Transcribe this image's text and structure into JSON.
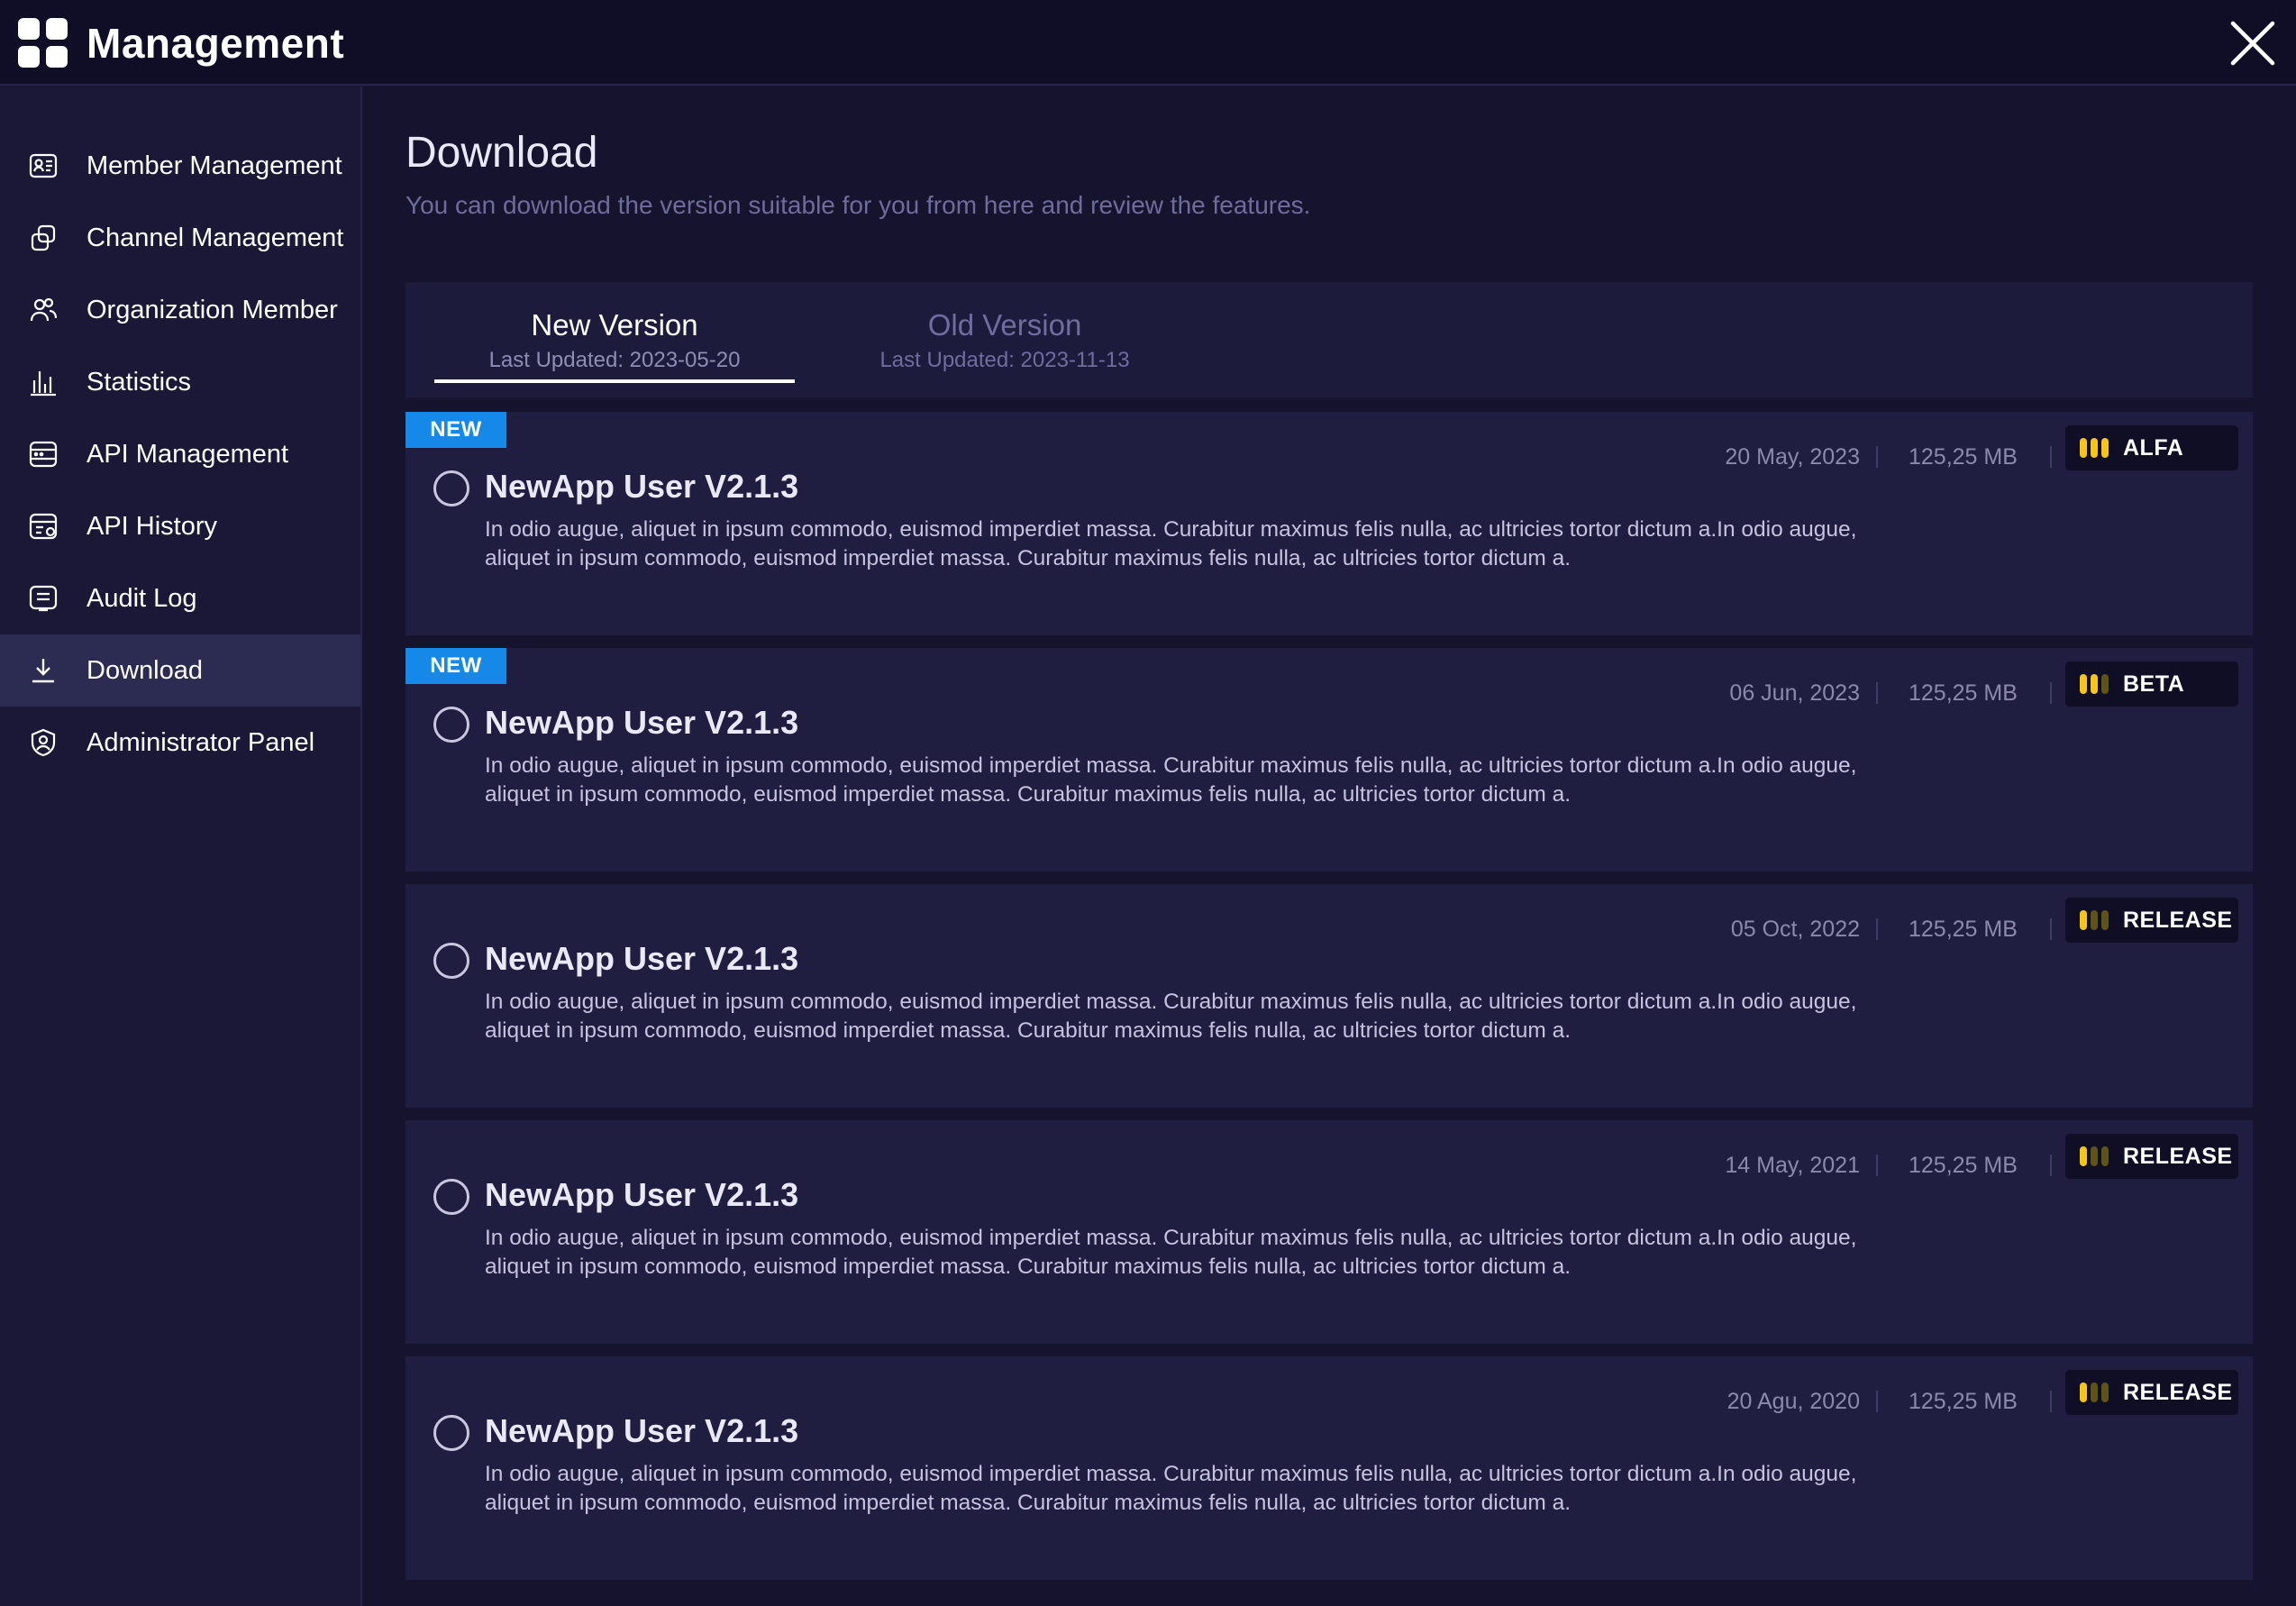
{
  "app": {
    "title": "Management"
  },
  "sidebar": {
    "items": [
      {
        "label": "Member Management",
        "icon": "id-card-icon"
      },
      {
        "label": "Channel Management",
        "icon": "link-icon"
      },
      {
        "label": "Organization Member",
        "icon": "users-icon"
      },
      {
        "label": "Statistics",
        "icon": "bar-chart-icon"
      },
      {
        "label": "API Management",
        "icon": "api-icon"
      },
      {
        "label": "API History",
        "icon": "api-history-icon"
      },
      {
        "label": "Audit Log",
        "icon": "log-icon"
      },
      {
        "label": "Download",
        "icon": "download-icon",
        "active": true
      },
      {
        "label": "Administrator Panel",
        "icon": "admin-icon"
      }
    ]
  },
  "main": {
    "title": "Download",
    "subtitle": "You can download the version suitable for you from here and review the features.",
    "tabs": [
      {
        "label": "New Version",
        "date": "Last Updated: 2023-05-20",
        "active": true
      },
      {
        "label": "Old Version",
        "date": "Last Updated: 2023-11-13",
        "active": false
      }
    ],
    "new_badge": "NEW",
    "versions": [
      {
        "title": "NewApp User V2.1.3",
        "date": "20 May, 2023",
        "size": "125,25 MB",
        "type": "ALFA",
        "level": 3,
        "is_new": true,
        "desc": "In odio augue, aliquet in ipsum commodo, euismod imperdiet massa. Curabitur maximus felis nulla, ac ultricies tortor dictum a.In odio augue, aliquet in ipsum commodo, euismod imperdiet massa. Curabitur maximus felis nulla, ac ultricies tortor dictum a."
      },
      {
        "title": "NewApp User V2.1.3",
        "date": "06 Jun, 2023",
        "size": "125,25 MB",
        "type": "BETA",
        "level": 2,
        "is_new": true,
        "desc": "In odio augue, aliquet in ipsum commodo, euismod imperdiet massa. Curabitur maximus felis nulla, ac ultricies tortor dictum a.In odio augue, aliquet in ipsum commodo, euismod imperdiet massa. Curabitur maximus felis nulla, ac ultricies tortor dictum a."
      },
      {
        "title": "NewApp User V2.1.3",
        "date": "05 Oct, 2022",
        "size": "125,25 MB",
        "type": "RELEASE",
        "level": 1,
        "is_new": false,
        "desc": "In odio augue, aliquet in ipsum commodo, euismod imperdiet massa. Curabitur maximus felis nulla, ac ultricies tortor dictum a.In odio augue, aliquet in ipsum commodo, euismod imperdiet massa. Curabitur maximus felis nulla, ac ultricies tortor dictum a."
      },
      {
        "title": "NewApp User V2.1.3",
        "date": "14 May, 2021",
        "size": "125,25 MB",
        "type": "RELEASE",
        "level": 1,
        "is_new": false,
        "desc": "In odio augue, aliquet in ipsum commodo, euismod imperdiet massa. Curabitur maximus felis nulla, ac ultricies tortor dictum a.In odio augue, aliquet in ipsum commodo, euismod imperdiet massa. Curabitur maximus felis nulla, ac ultricies tortor dictum a."
      },
      {
        "title": "NewApp User V2.1.3",
        "date": "20 Agu, 2020",
        "size": "125,25 MB",
        "type": "RELEASE",
        "level": 1,
        "is_new": false,
        "desc": "In odio augue, aliquet in ipsum commodo, euismod imperdiet massa. Curabitur maximus felis nulla, ac ultricies tortor dictum a.In odio augue, aliquet in ipsum commodo, euismod imperdiet massa. Curabitur maximus felis nulla, ac ultricies tortor dictum a."
      }
    ]
  },
  "colors": {
    "background": "#15132e",
    "sidebar": "#1a1836",
    "active_item": "#2c2b52",
    "card": "#1f1d40",
    "new_badge": "#1588e8",
    "level_on": "#f5c518",
    "level_off": "#5f5418"
  }
}
